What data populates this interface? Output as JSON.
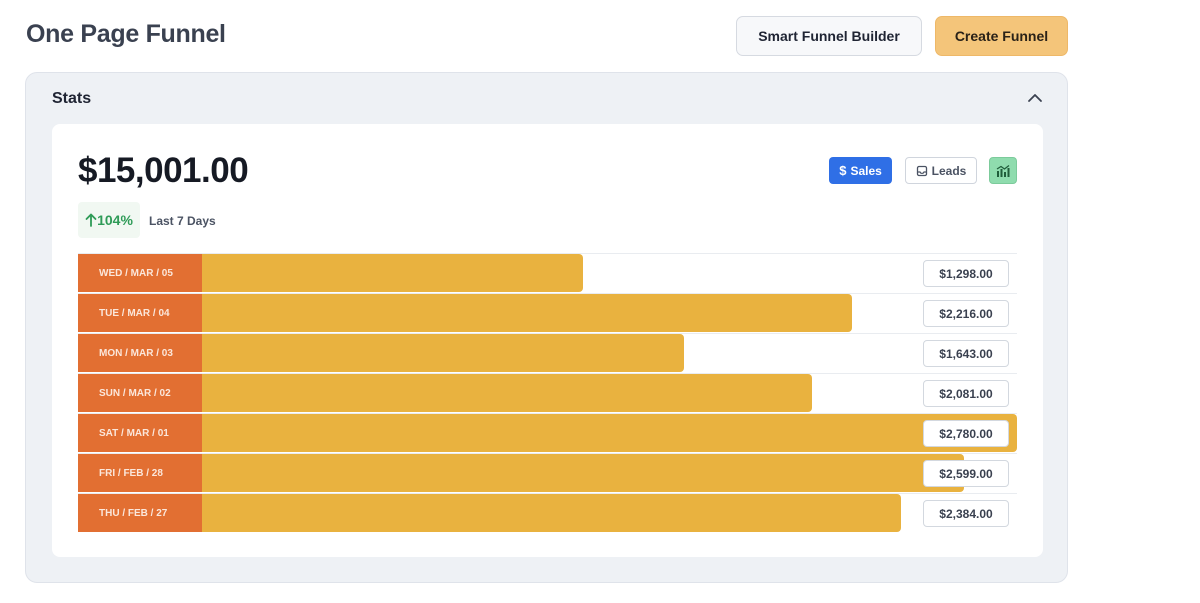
{
  "header": {
    "title": "One Page Funnel",
    "smart_builder_label": "Smart Funnel Builder",
    "create_label": "Create Funnel"
  },
  "stats": {
    "title": "Stats",
    "total": "$15,001.00",
    "change": "104%",
    "period": "Last 7 Days",
    "tabs": {
      "sales": "Sales",
      "leads": "Leads"
    }
  },
  "chart_data": {
    "type": "bar",
    "categories": [
      "WED / MAR / 05",
      "TUE / MAR / 04",
      "MON / MAR / 03",
      "SUN / MAR / 02",
      "SAT / MAR / 01",
      "FRI / FEB / 28",
      "THU / FEB / 27"
    ],
    "values": [
      1298,
      2216,
      1643,
      2081,
      2780,
      2599,
      2384
    ],
    "value_labels": [
      "$1,298.00",
      "$2,216.00",
      "$1,643.00",
      "$2,081.00",
      "$2,780.00",
      "$2,599.00",
      "$2,384.00"
    ],
    "orientation": "horizontal",
    "bar_color": "#e9b23f",
    "label_color": "#e26f32"
  },
  "colors": {
    "accent_blue": "#2f6fe6",
    "accent_orange": "#f4c57a",
    "positive_green": "#2e9b57"
  }
}
